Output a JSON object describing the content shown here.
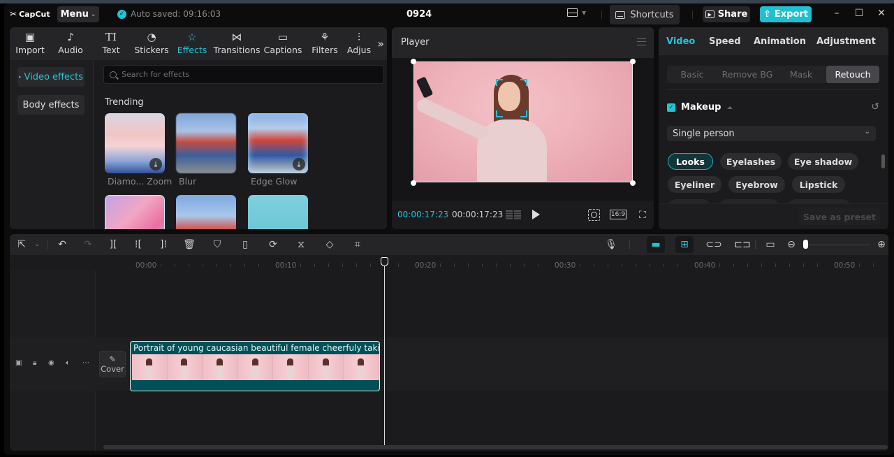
{
  "app": {
    "logo": "CapCut",
    "menu_label": "Menu",
    "autosave": "Auto saved: 09:16:03",
    "project_title": "0924",
    "shortcuts_label": "Shortcuts",
    "share_label": "Share",
    "export_label": "Export",
    "accent_color": "#22c3d6"
  },
  "media": {
    "tabs": [
      {
        "label": "Import",
        "icon": "import-icon",
        "glyph": "▣"
      },
      {
        "label": "Audio",
        "icon": "audio-icon",
        "glyph": "♪"
      },
      {
        "label": "Text",
        "icon": "text-icon",
        "glyph": "TI"
      },
      {
        "label": "Stickers",
        "icon": "sticker-icon",
        "glyph": "◔"
      },
      {
        "label": "Effects",
        "icon": "effects-star-icon",
        "glyph": "☆"
      },
      {
        "label": "Transitions",
        "icon": "transitions-icon",
        "glyph": "⋈"
      },
      {
        "label": "Captions",
        "icon": "captions-icon",
        "glyph": "▭"
      },
      {
        "label": "Filters",
        "icon": "filters-icon",
        "glyph": "⚘"
      },
      {
        "label": "Adjus",
        "icon": "adjust-icon",
        "glyph": "⫶"
      }
    ],
    "active_tab": "Effects",
    "side": {
      "video_effects": "Video effects",
      "body_effects": "Body effects"
    },
    "search_placeholder": "Search for effects",
    "section_title": "Trending",
    "effects": [
      {
        "label": "Diamo... Zoom",
        "downloadable": true
      },
      {
        "label": "Blur",
        "downloadable": false
      },
      {
        "label": "Edge Glow",
        "downloadable": true
      },
      {
        "label": "",
        "downloadable": false
      },
      {
        "label": "",
        "downloadable": false
      },
      {
        "label": "",
        "downloadable": false
      }
    ]
  },
  "player": {
    "title": "Player",
    "current_time": "00:00:17:23",
    "total_time": "00:00:17:23",
    "ratio": "16:9"
  },
  "properties": {
    "tabs": [
      "Video",
      "Speed",
      "Animation",
      "Adjustment"
    ],
    "active_tab": "Video",
    "subtabs": [
      "Basic",
      "Remove BG",
      "Mask",
      "Retouch"
    ],
    "active_subtab": "Retouch",
    "makeup_label": "Makeup",
    "makeup_enabled": true,
    "person_select": "Single person",
    "chips": [
      "Looks",
      "Eyelashes",
      "Eye shadow",
      "Eyeliner",
      "Eyebrow",
      "Lipstick"
    ],
    "active_chip": "Looks",
    "save_preset": "Save as preset"
  },
  "timeline": {
    "ruler": [
      "00:00",
      "00:10",
      "00:20",
      "00:30",
      "00:40",
      "00:50"
    ],
    "cover_label": "Cover",
    "clip_title": "Portrait of young caucasian beautiful female cheerfuly taking selfie",
    "playhead_time": "00:00:17:23"
  }
}
